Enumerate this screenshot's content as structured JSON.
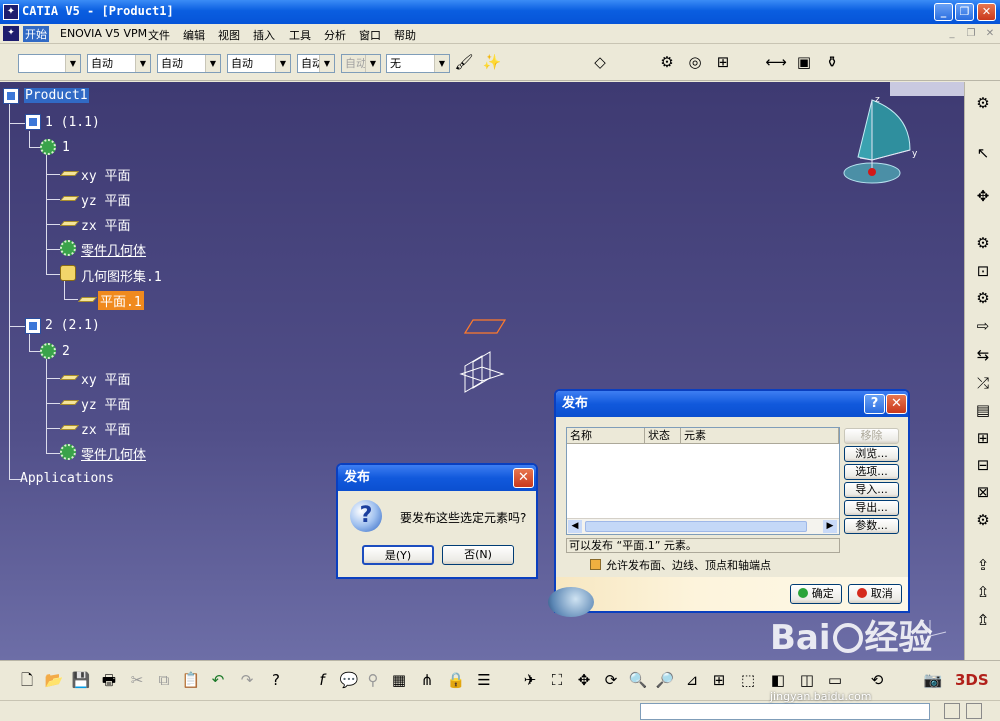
{
  "window": {
    "title": "CATIA V5 - [Product1]",
    "app_icon": "catia-icon"
  },
  "menu": {
    "items": [
      "开始",
      "ENOVIA V5 VPM",
      "文件",
      "编辑",
      "视图",
      "插入",
      "工具",
      "分析",
      "窗口",
      "帮助"
    ],
    "active": "开始"
  },
  "toolbar": {
    "dropdowns": [
      "",
      "自动",
      "自动",
      "自动",
      "自动",
      "自动",
      "无"
    ]
  },
  "tree": {
    "root": "Product1",
    "nodes": {
      "inst1": "1 (1.1)",
      "part1": "1",
      "xy1": "xy 平面",
      "yz1": "yz 平面",
      "zx1": "zx 平面",
      "body1": "零件几何体",
      "gs1": "几何图形集.1",
      "plane1": "平面.1",
      "inst2": "2 (2.1)",
      "part2": "2",
      "xy2": "xy 平面",
      "yz2": "yz 平面",
      "zx2": "zx 平面",
      "body2": "零件几何体",
      "apps": "Applications"
    }
  },
  "compass": {
    "z": "z",
    "y": "y"
  },
  "confirm_dialog": {
    "title": "发布",
    "message": "要发布这些选定元素吗?",
    "yes": "是(Y)",
    "no": "否(N)"
  },
  "publish_dialog": {
    "title": "发布",
    "columns": [
      "名称",
      "状态",
      "元素"
    ],
    "buttons": [
      "移除",
      "浏览...",
      "选项...",
      "导入...",
      "导出...",
      "参数..."
    ],
    "status_text": "可以发布 “平面.1” 元素。",
    "checkbox_label": "允许发布面、边线、顶点和轴端点",
    "checkbox_checked": true,
    "ok": "确定",
    "cancel": "取消"
  },
  "watermark": {
    "brand": "Bai",
    "brand2": "经验",
    "url": "jingyan.baidu.com"
  },
  "colors": {
    "title_bar": "#0a5ee0",
    "viewport_top": "#3e3a72",
    "viewport_bottom": "#6d6ea7",
    "selection": "#316ac5",
    "highlight": "#f08a1e"
  }
}
